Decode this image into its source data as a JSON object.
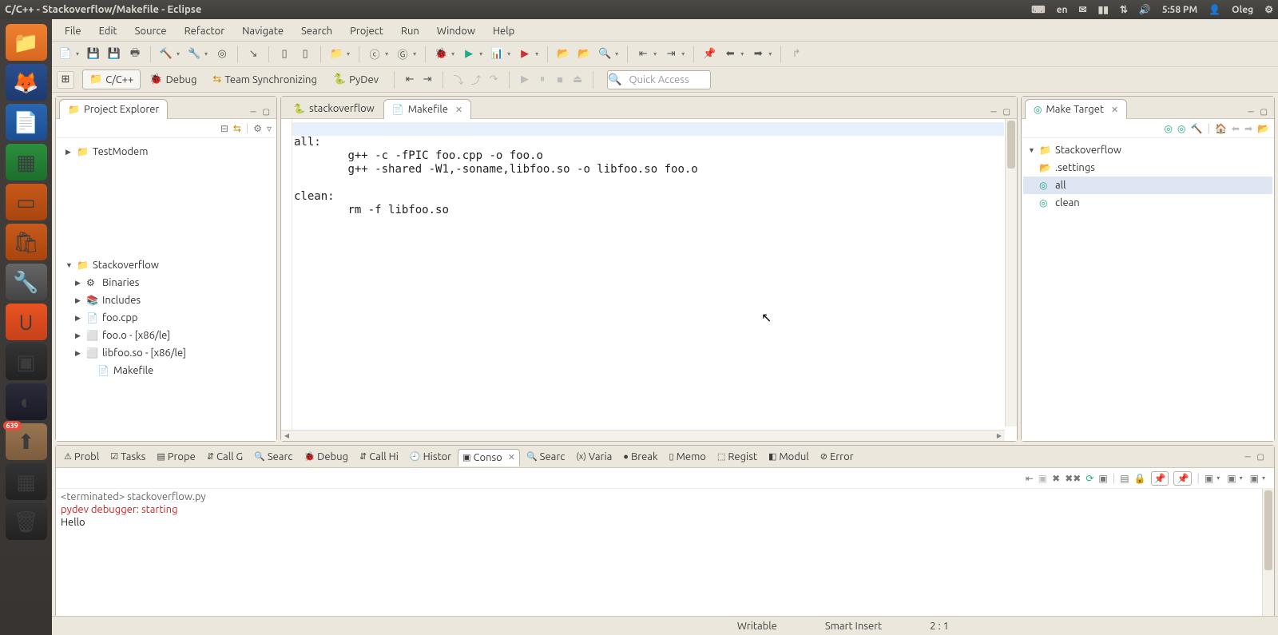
{
  "topbar": {
    "title": "C/C++ - Stackoverflow/Makefile - Eclipse",
    "lang": "en",
    "time": "5:58 PM",
    "user": "Oleg"
  },
  "launcher": {
    "updates_badge": "639"
  },
  "menubar": [
    "File",
    "Edit",
    "Source",
    "Refactor",
    "Navigate",
    "Search",
    "Project",
    "Run",
    "Window",
    "Help"
  ],
  "quick_access": {
    "placeholder": "Quick Access"
  },
  "perspectives": {
    "items": [
      {
        "label": "C/C++",
        "active": true
      },
      {
        "label": "Debug",
        "active": false
      },
      {
        "label": "Team Synchronizing",
        "active": false
      },
      {
        "label": "PyDev",
        "active": false
      }
    ]
  },
  "projectExplorer": {
    "title": "Project Explorer",
    "tree": [
      {
        "label": "TestModem",
        "icon": "📁",
        "caret": "▶",
        "indent": 0
      },
      {
        "label": "Stackoverflow",
        "icon": "📁",
        "caret": "▼",
        "indent": 0
      },
      {
        "label": "Binaries",
        "icon": "⚙",
        "caret": "▶",
        "indent": 1
      },
      {
        "label": "Includes",
        "icon": "📚",
        "caret": "▶",
        "indent": 1
      },
      {
        "label": "foo.cpp",
        "icon": "📄",
        "caret": "▶",
        "indent": 1
      },
      {
        "label": "foo.o - [x86/le]",
        "icon": "⬜",
        "caret": "▶",
        "indent": 1
      },
      {
        "label": "libfoo.so - [x86/le]",
        "icon": "⬜",
        "caret": "▶",
        "indent": 1
      },
      {
        "label": "Makefile",
        "icon": "📄",
        "caret": "",
        "indent": 2
      }
    ]
  },
  "editor": {
    "tabs": [
      {
        "label": "stackoverflow",
        "active": false,
        "icon": "🐍"
      },
      {
        "label": "Makefile",
        "active": true,
        "icon": "📄"
      }
    ],
    "content": "\nall:\n\tg++ -c -fPIC foo.cpp -o foo.o\n\tg++ -shared -W1,-soname,libfoo.so -o libfoo.so foo.o\n\nclean:\n\trm -f libfoo.so"
  },
  "makeTarget": {
    "title": "Make Target",
    "tree": [
      {
        "label": "Stackoverflow",
        "icon": "📁",
        "caret": "▼",
        "indent": 0,
        "sel": false
      },
      {
        "label": ".settings",
        "icon": "📂",
        "caret": "",
        "indent": 1,
        "sel": false
      },
      {
        "label": "all",
        "icon": "◎",
        "caret": "",
        "indent": 1,
        "sel": true
      },
      {
        "label": "clean",
        "icon": "◎",
        "caret": "",
        "indent": 1,
        "sel": false
      }
    ]
  },
  "bottomTabs": [
    {
      "label": "Probl",
      "icon": "⚠"
    },
    {
      "label": "Tasks",
      "icon": "☑"
    },
    {
      "label": "Prope",
      "icon": "▤"
    },
    {
      "label": "Call G",
      "icon": "⇵"
    },
    {
      "label": "Searc",
      "icon": "🔍"
    },
    {
      "label": "Debug",
      "icon": "🐞"
    },
    {
      "label": "Call Hi",
      "icon": "⇵"
    },
    {
      "label": "Histor",
      "icon": "🕘"
    },
    {
      "label": "Conso",
      "icon": "▣",
      "active": true
    },
    {
      "label": "Searc",
      "icon": "🔍"
    },
    {
      "label": "Varia",
      "icon": "(x)"
    },
    {
      "label": "Break",
      "icon": "●"
    },
    {
      "label": "Memo",
      "icon": "▯"
    },
    {
      "label": "Regist",
      "icon": "⬚"
    },
    {
      "label": "Modul",
      "icon": "◧"
    },
    {
      "label": "Error",
      "icon": "⊘"
    }
  ],
  "console": {
    "header": "<terminated> stackoverflow.py",
    "line_red": "pydev debugger: starting",
    "line_txt": "Hello"
  },
  "status": {
    "writable": "Writable",
    "mode": "Smart Insert",
    "pos": "2 : 1"
  }
}
